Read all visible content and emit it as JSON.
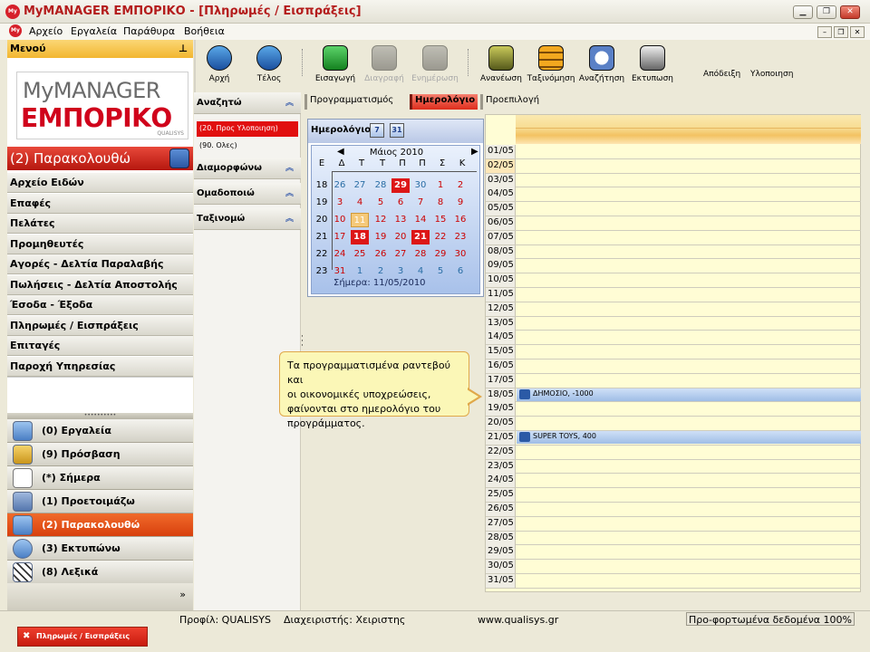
{
  "window": {
    "title": "MyMANAGER ΕΜΠΟΡΙΚΟ - [Πληρωμές / Εισπράξεις]",
    "logo_text": "My"
  },
  "menubar": [
    "Αρχείο",
    "Εργαλεία",
    "Παράθυρα",
    "Βοήθεια"
  ],
  "sidebar": {
    "header": "Μενού",
    "logo_line1": "MyMANAGER",
    "logo_line2": "ΕΜΠΟΡΙΚΟ",
    "logo_sub": "QUALISYS",
    "section_title": "(2) Παρακολουθώ",
    "items": [
      "Αρχείο Ειδών",
      "Επαφές",
      "Πελάτες",
      "Προμηθευτές",
      "Αγορές - Δελτία Παραλαβής",
      "Πωλήσεις - Δελτία Αποστολής",
      "Έσοδα - Έξοδα",
      "Πληρωμές / Εισπράξεις",
      "Επιταγές",
      "Παροχή Υπηρεσίας"
    ],
    "modules": [
      {
        "label": "(0) Εργαλεία",
        "icon": "tools-icon"
      },
      {
        "label": "(9) Πρόσβαση",
        "icon": "keys-icon"
      },
      {
        "label": "(*) Σήμερα",
        "icon": "calendar-icon"
      },
      {
        "label": "(1) Προετοιμάζω",
        "icon": "org-chart-icon"
      },
      {
        "label": "(2) Παρακολουθώ",
        "icon": "monitor-icon"
      },
      {
        "label": "(3) Εκτυπώνω",
        "icon": "pie-chart-icon"
      },
      {
        "label": "(8) Λεξικά",
        "icon": "dictionary-icon"
      }
    ],
    "active_module": 4
  },
  "toolbar": {
    "buttons": [
      "Αρχή",
      "Τέλος",
      "Εισαγωγή",
      "Διαγραφή",
      "Ενημέρωση",
      "Ανανέωση",
      "Ταξινόμηση",
      "Αναζήτηση",
      "Εκτυπωση"
    ],
    "plain": [
      "Απόδειξη",
      "Υλοποιηση"
    ]
  },
  "filters": {
    "sections": [
      "Αναζητώ",
      "Διαμορφώνω",
      "Ομαδοποιώ",
      "Ταξινομώ"
    ],
    "options": [
      "(20. Προς Υλοποιηση)",
      "(90. Ολες)"
    ]
  },
  "tabs": [
    "Προγραμματισμός",
    "Ημερολόγιο",
    "Προεπιλογή"
  ],
  "active_tab": 1,
  "calendar": {
    "title": "Ημερολόγιο",
    "btn7": "7",
    "btn31": "31",
    "month": "Μάιος 2010",
    "weekdays": [
      "Ε",
      "Δ",
      "Τ",
      "Τ",
      "Π",
      "Π",
      "Σ",
      "Κ"
    ],
    "weeks": [
      {
        "wk": "18",
        "days": [
          "26",
          "27",
          "28",
          "29",
          "30",
          "1",
          "2"
        ]
      },
      {
        "wk": "19",
        "days": [
          "3",
          "4",
          "5",
          "6",
          "7",
          "8",
          "9"
        ]
      },
      {
        "wk": "20",
        "days": [
          "10",
          "11",
          "12",
          "13",
          "14",
          "15",
          "16"
        ]
      },
      {
        "wk": "21",
        "days": [
          "17",
          "18",
          "19",
          "20",
          "21",
          "22",
          "23"
        ]
      },
      {
        "wk": "22",
        "days": [
          "24",
          "25",
          "26",
          "27",
          "28",
          "29",
          "30"
        ]
      },
      {
        "wk": "23",
        "days": [
          "31",
          "1",
          "2",
          "3",
          "4",
          "5",
          "6"
        ]
      }
    ],
    "today_label": "Σήμερα: 11/05/2010"
  },
  "tooltip": [
    "Τα προγραμματισμένα ραντεβού και",
    "οι οικονομικές υποχρεώσεις,",
    "φαίνονται στο ημερολόγιο του",
    "προγράμματος."
  ],
  "schedule": {
    "dates": [
      "01/05",
      "02/05",
      "03/05",
      "04/05",
      "05/05",
      "06/05",
      "07/05",
      "08/05",
      "09/05",
      "10/05",
      "11/05",
      "12/05",
      "13/05",
      "14/05",
      "15/05",
      "16/05",
      "17/05",
      "18/05",
      "19/05",
      "20/05",
      "21/05",
      "22/05",
      "23/05",
      "24/05",
      "25/05",
      "26/05",
      "27/05",
      "28/05",
      "29/05",
      "30/05",
      "31/05"
    ],
    "current_index": 1,
    "entries": {
      "17": "ΔΗΜΟΣΙΟ, -1000",
      "20": "SUPER TOYS, 400"
    }
  },
  "statusbar": {
    "profile": "Προφίλ: QUALISYS",
    "admin": "Διαχειριστής: Χειριστης",
    "url": "www.qualisys.gr",
    "progress": "Προ-φορτωμένα δεδομένα 100%"
  },
  "taskbar": {
    "label": "Πληρωμές / Εισπράξεις"
  }
}
